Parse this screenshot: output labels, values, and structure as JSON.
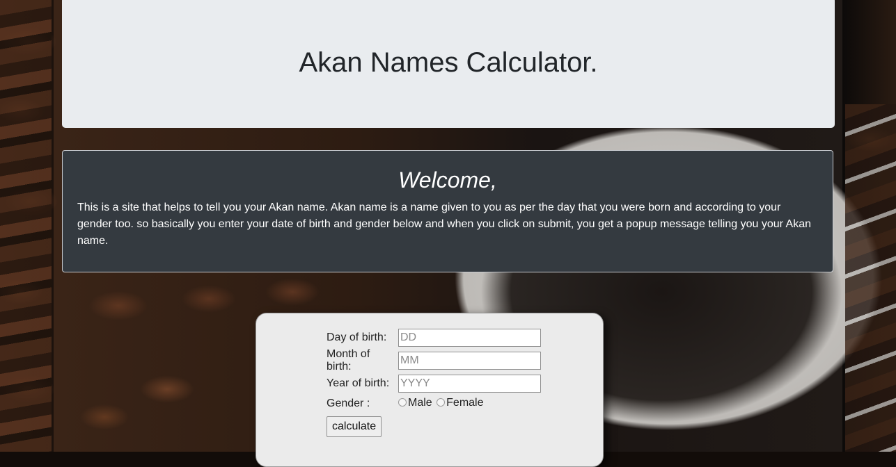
{
  "header": {
    "title": "Akan Names Calculator."
  },
  "welcome": {
    "heading": "Welcome,",
    "body": "This is a site that helps to tell you your Akan name. Akan name is a name given to you as per the day that you were born and according to your gender too. so basically you enter your date of birth and gender below and when you click on submit, you get a popup message telling you your Akan name."
  },
  "form": {
    "day_label": "Day of birth:",
    "day_placeholder": "DD",
    "month_label": "Month of birth:",
    "month_placeholder": "MM",
    "year_label": "Year of birth:",
    "year_placeholder": "YYYY",
    "gender_label": "Gender :",
    "gender_options": [
      "Male",
      "Female"
    ],
    "submit_label": "calculate"
  }
}
